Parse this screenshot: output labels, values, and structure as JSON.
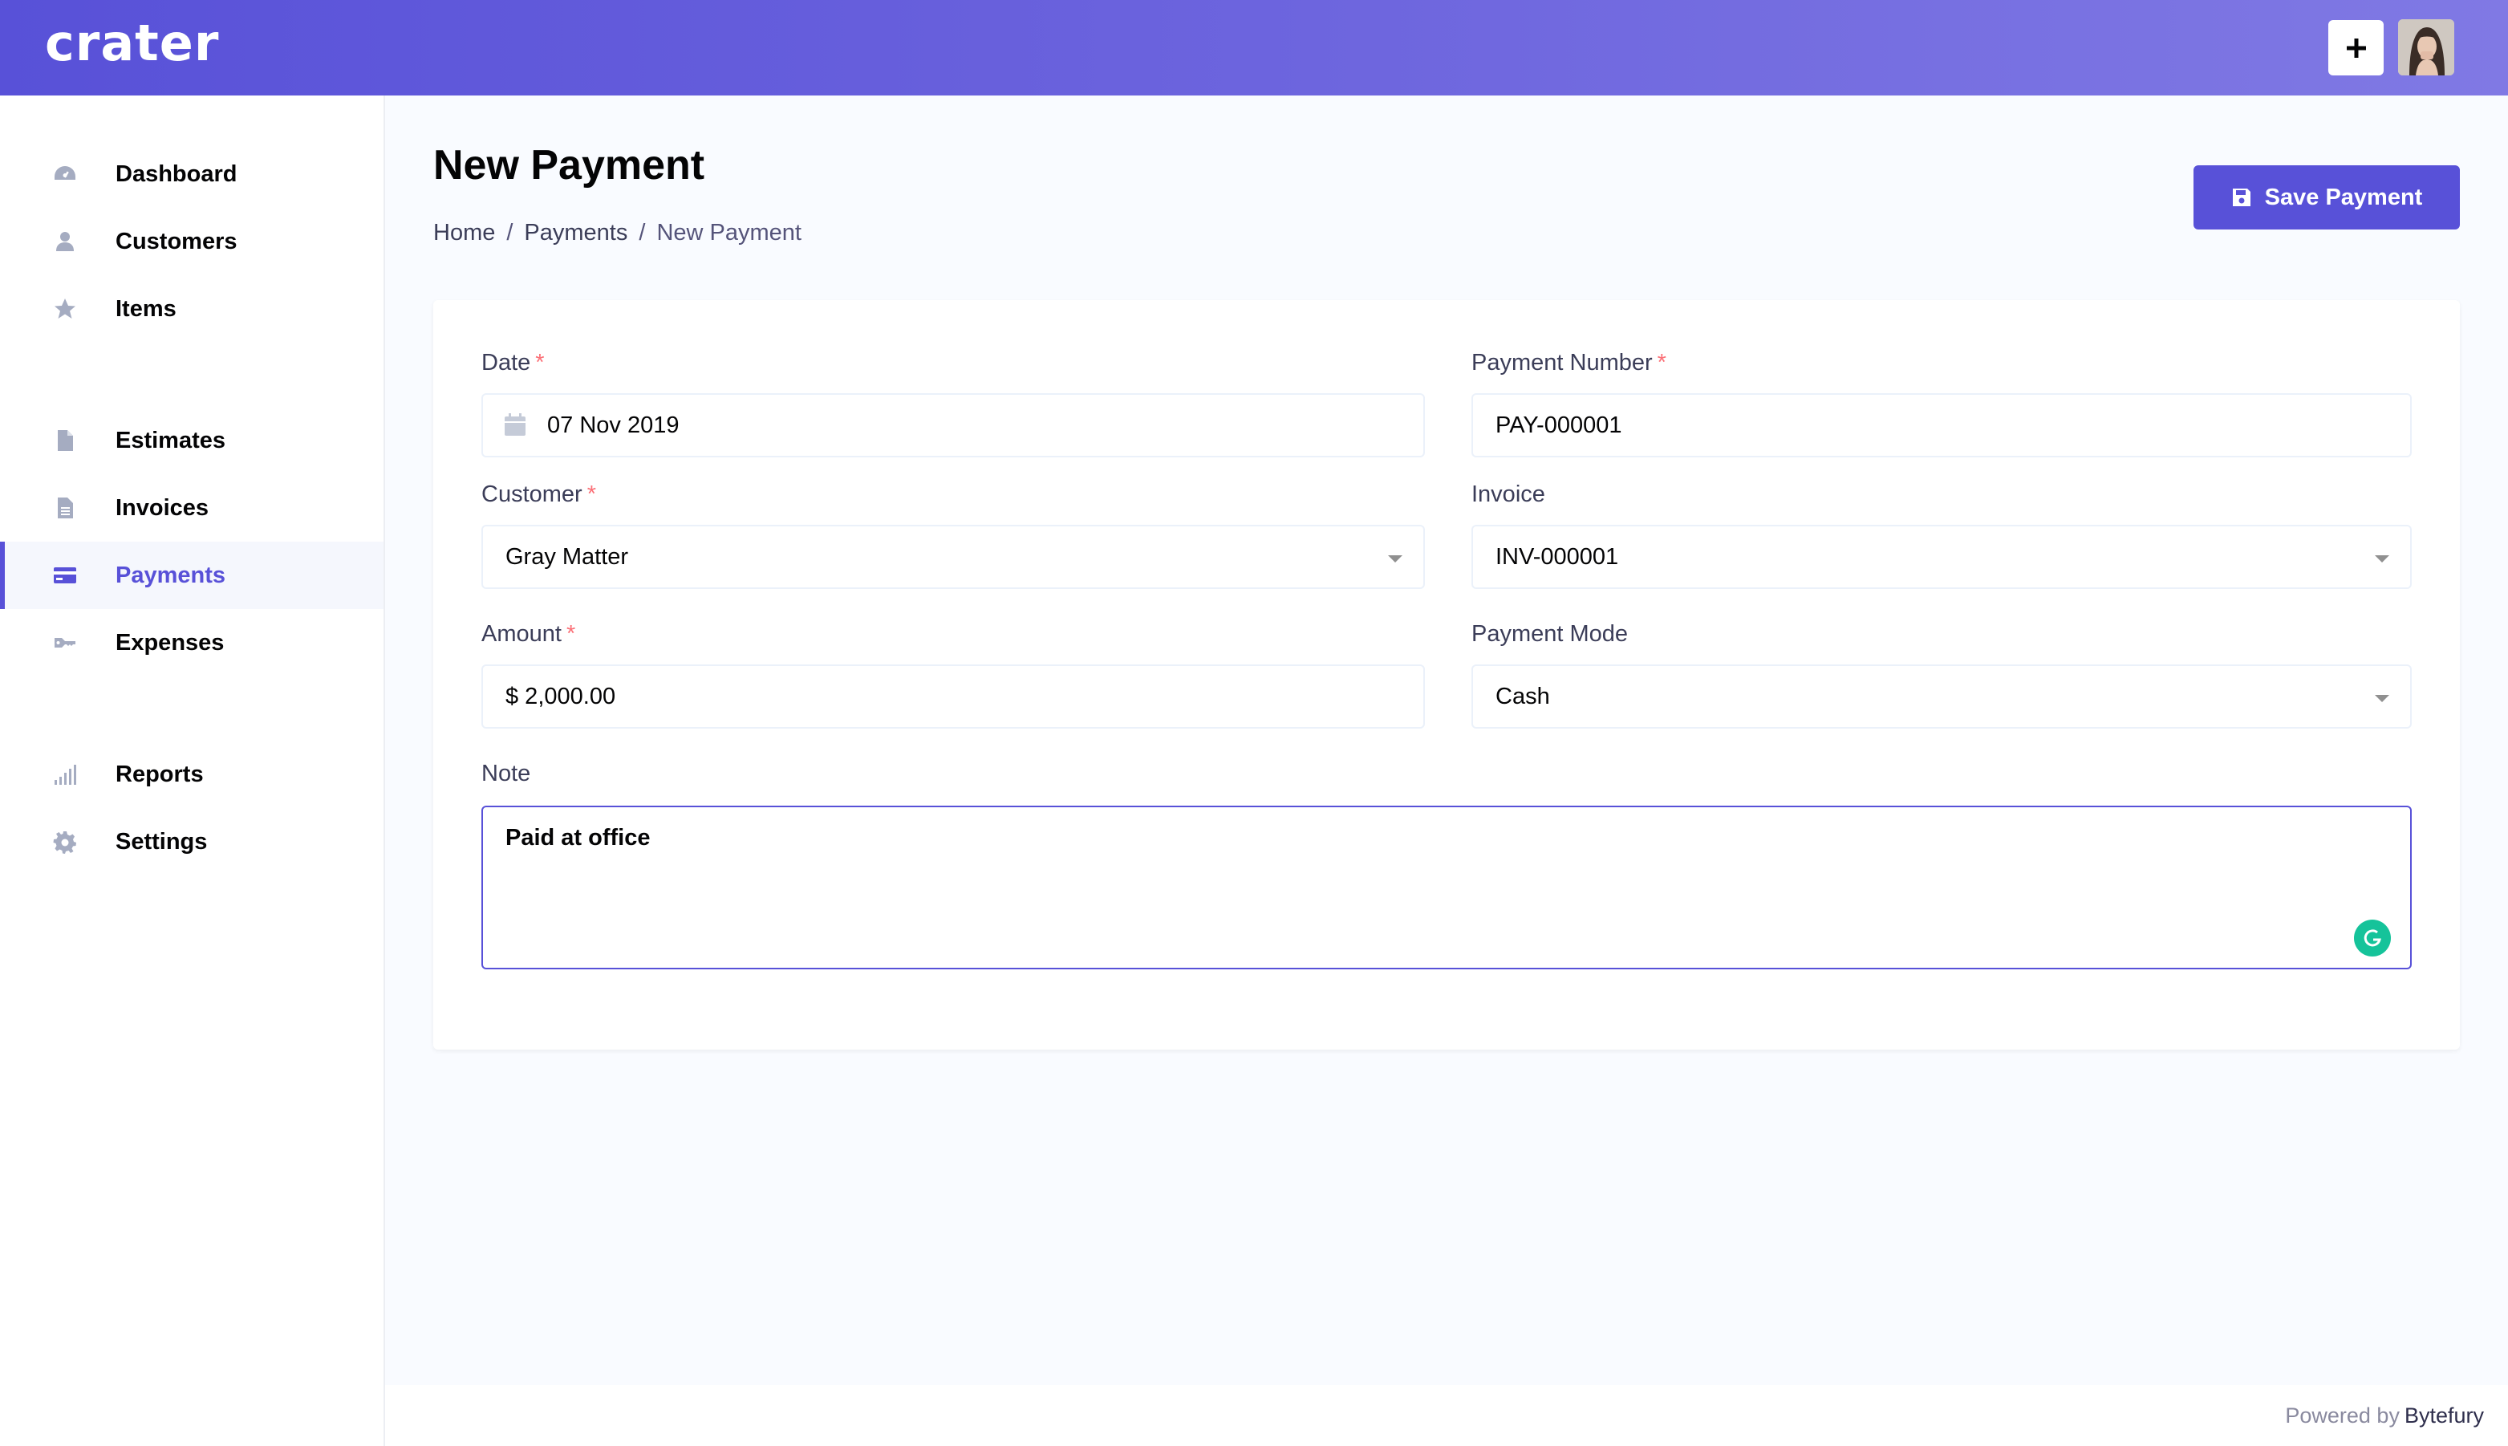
{
  "header": {
    "logo": "crater",
    "add_icon": "plus-icon",
    "avatar_icon": "user-avatar"
  },
  "sidebar": {
    "items": [
      {
        "label": "Dashboard",
        "icon": "dashboard-icon"
      },
      {
        "label": "Customers",
        "icon": "user-icon"
      },
      {
        "label": "Items",
        "icon": "star-icon"
      },
      {
        "label": "Estimates",
        "icon": "document-icon"
      },
      {
        "label": "Invoices",
        "icon": "file-text-icon"
      },
      {
        "label": "Payments",
        "icon": "credit-card-icon",
        "active": true
      },
      {
        "label": "Expenses",
        "icon": "key-icon"
      },
      {
        "label": "Reports",
        "icon": "signal-icon"
      },
      {
        "label": "Settings",
        "icon": "cog-icon"
      }
    ]
  },
  "page": {
    "title": "New Payment",
    "breadcrumb": [
      "Home",
      "Payments",
      "New Payment"
    ],
    "separator": "/",
    "save_label": "Save Payment"
  },
  "form": {
    "date": {
      "label": "Date",
      "required": "*",
      "value": "07 Nov 2019"
    },
    "payment_number": {
      "label": "Payment Number",
      "required": "*",
      "value": "PAY-000001"
    },
    "customer": {
      "label": "Customer",
      "required": "*",
      "value": "Gray Matter"
    },
    "invoice": {
      "label": "Invoice",
      "value": "INV-000001"
    },
    "amount": {
      "label": "Amount",
      "required": "*",
      "value": "$ 2,000.00"
    },
    "payment_mode": {
      "label": "Payment Mode",
      "value": "Cash"
    },
    "note": {
      "label": "Note",
      "value": "Paid at office"
    }
  },
  "footer": {
    "prefix": "Powered by",
    "brand": "Bytefury"
  },
  "colors": {
    "accent": "#5851d8",
    "required": "#fb7178",
    "grammarly": "#15c39a"
  }
}
